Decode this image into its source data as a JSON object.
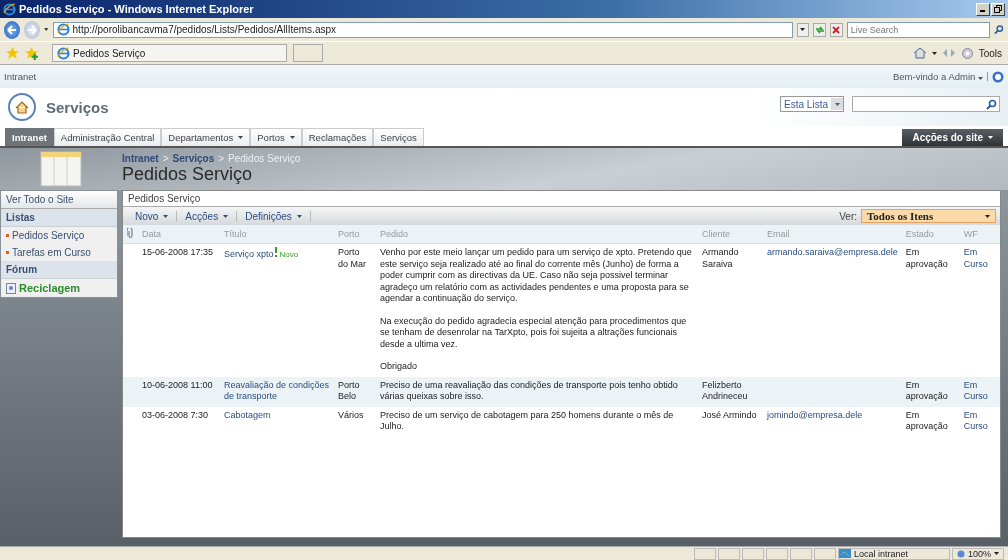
{
  "window": {
    "title": "Pedidos Serviço - Windows Internet Explorer"
  },
  "address_bar": {
    "url": "http://porolibancavma7/pedidos/Lists/Pedidos/AllItems.aspx"
  },
  "browser_search": {
    "placeholder": "Live Search"
  },
  "browser_tab": {
    "label": "Pedidos Serviço"
  },
  "command_bar": {
    "tools": "Tools"
  },
  "top_bar": {
    "site": "Intranet",
    "welcome": "Bem-vindo a Admin"
  },
  "header": {
    "site_title": "Serviços",
    "search_scope": "Esta Lista"
  },
  "nav_tabs": [
    {
      "label": "Intranet",
      "selected": true,
      "has_menu": false
    },
    {
      "label": "Administração Central",
      "selected": false,
      "has_menu": false
    },
    {
      "label": "Departamentos",
      "selected": false,
      "has_menu": true
    },
    {
      "label": "Portos",
      "selected": false,
      "has_menu": true
    },
    {
      "label": "Reclamações",
      "selected": false,
      "has_menu": false
    },
    {
      "label": "Serviços",
      "selected": false,
      "has_menu": false
    }
  ],
  "site_actions": "Acções do site",
  "breadcrumb": {
    "separator": ">",
    "items": [
      "Intranet",
      "Serviços",
      "Pedidos Serviço"
    ]
  },
  "page_title": "Pedidos Serviço",
  "sidebar": {
    "view_all": "Ver Todo o Site",
    "sections": [
      {
        "title": "Listas",
        "items": [
          {
            "label": "Pedidos Serviço",
            "kind": "list"
          },
          {
            "label": "Tarefas em Curso",
            "kind": "list"
          }
        ]
      },
      {
        "title": "Fórum",
        "items": [
          {
            "label": "Reciclagem",
            "kind": "discussion"
          }
        ]
      }
    ]
  },
  "list": {
    "caption": "Pedidos Serviço",
    "menus": [
      "Novo",
      "Acções",
      "Definições"
    ],
    "view_label": "Ver:",
    "view": "Todos os Itens",
    "columns": [
      "Data",
      "Título",
      "Porto",
      "Pedido",
      "Cliente",
      "Email",
      "Estado",
      "WF"
    ],
    "rows": [
      {
        "data": "15-06-2008 17:35",
        "titulo": "Serviço xpto",
        "badge": "Novo",
        "porto": "Porto do Mar",
        "pedido": [
          "Venho por este meio lançar um pedido para um serviço de xpto. Pretendo que este serviço seja realizado até ao final do corrente mês (Junho) de forma a poder cumprir com as directivas da UE. Caso não seja possivel terminar agradeço um relatório com as actividades pendentes e uma proposta para se agendar a continuação do serviço.",
          "Na execução do pedido agradecia especial atenção para procedimentos que se tenham de desenrolar na TarXpto, pois foi sujeita a altrações funcionais desde a ultima vez.",
          "Obrigado"
        ],
        "cliente": "Armando Saraiva",
        "email": "armando.saraiva@empresa.dele",
        "estado": "Em aprovação",
        "wf": "Em Curso"
      },
      {
        "data": "10-06-2008 11:00",
        "titulo": "Reavaliação de condições de transporte",
        "porto": "Porto Belo",
        "pedido": [
          "Preciso de uma reavaliação das condições de transporte pois tenho obtido várias queixas sobre isso."
        ],
        "cliente": "Felizberto Andrineceu",
        "estado": "Em aprovação",
        "wf": "Em Curso"
      },
      {
        "data": "03-06-2008 7:30",
        "titulo": "Cabotagem",
        "porto": "Vários",
        "pedido": [
          "Preciso de um serviço de cabotagem para 250 homens durante o mês de Julho."
        ],
        "cliente": "José Armindo",
        "email": "jomindo@empresa.dele",
        "estado": "Em aprovação",
        "wf": "Em Curso"
      }
    ]
  },
  "status_bar": {
    "zone": "Local intranet",
    "zoom": "100%"
  }
}
